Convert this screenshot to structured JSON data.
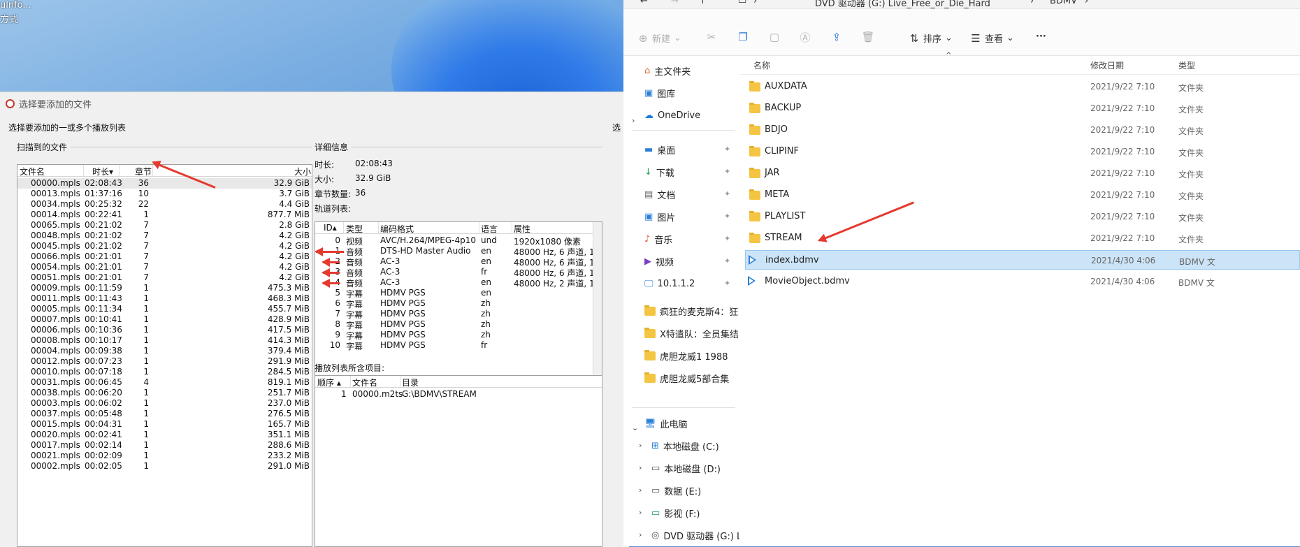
{
  "desktop": {
    "line1": "ulnfo...",
    "line2": "方式"
  },
  "dialog": {
    "title": "选择要添加的文件",
    "instruction": "选择要添加的一或多个播放列表",
    "right_cut": "选",
    "scanned_label": "扫描到的文件",
    "detail_label": "详细信息",
    "files_headers": [
      "文件名",
      "时长",
      "章节",
      "大小"
    ],
    "files": [
      {
        "name": "00000.mpls",
        "dur": "02:08:43",
        "ch": "36",
        "size": "32.9 GiB"
      },
      {
        "name": "00013.mpls",
        "dur": "01:37:16",
        "ch": "10",
        "size": "3.7 GiB"
      },
      {
        "name": "00034.mpls",
        "dur": "00:25:32",
        "ch": "22",
        "size": "4.4 GiB"
      },
      {
        "name": "00014.mpls",
        "dur": "00:22:41",
        "ch": "1",
        "size": "877.7 MiB"
      },
      {
        "name": "00065.mpls",
        "dur": "00:21:02",
        "ch": "7",
        "size": "2.8 GiB"
      },
      {
        "name": "00048.mpls",
        "dur": "00:21:02",
        "ch": "7",
        "size": "4.2 GiB"
      },
      {
        "name": "00045.mpls",
        "dur": "00:21:02",
        "ch": "7",
        "size": "4.2 GiB"
      },
      {
        "name": "00066.mpls",
        "dur": "00:21:01",
        "ch": "7",
        "size": "4.2 GiB"
      },
      {
        "name": "00054.mpls",
        "dur": "00:21:01",
        "ch": "7",
        "size": "4.2 GiB"
      },
      {
        "name": "00051.mpls",
        "dur": "00:21:01",
        "ch": "7",
        "size": "4.2 GiB"
      },
      {
        "name": "00009.mpls",
        "dur": "00:11:59",
        "ch": "1",
        "size": "475.3 MiB"
      },
      {
        "name": "00011.mpls",
        "dur": "00:11:43",
        "ch": "1",
        "size": "468.3 MiB"
      },
      {
        "name": "00005.mpls",
        "dur": "00:11:34",
        "ch": "1",
        "size": "455.7 MiB"
      },
      {
        "name": "00007.mpls",
        "dur": "00:10:41",
        "ch": "1",
        "size": "428.9 MiB"
      },
      {
        "name": "00006.mpls",
        "dur": "00:10:36",
        "ch": "1",
        "size": "417.5 MiB"
      },
      {
        "name": "00008.mpls",
        "dur": "00:10:17",
        "ch": "1",
        "size": "414.3 MiB"
      },
      {
        "name": "00004.mpls",
        "dur": "00:09:38",
        "ch": "1",
        "size": "379.4 MiB"
      },
      {
        "name": "00012.mpls",
        "dur": "00:07:23",
        "ch": "1",
        "size": "291.9 MiB"
      },
      {
        "name": "00010.mpls",
        "dur": "00:07:18",
        "ch": "1",
        "size": "284.5 MiB"
      },
      {
        "name": "00031.mpls",
        "dur": "00:06:45",
        "ch": "4",
        "size": "819.1 MiB"
      },
      {
        "name": "00038.mpls",
        "dur": "00:06:20",
        "ch": "1",
        "size": "251.7 MiB"
      },
      {
        "name": "00003.mpls",
        "dur": "00:06:02",
        "ch": "1",
        "size": "237.0 MiB"
      },
      {
        "name": "00037.mpls",
        "dur": "00:05:48",
        "ch": "1",
        "size": "276.5 MiB"
      },
      {
        "name": "00015.mpls",
        "dur": "00:04:31",
        "ch": "1",
        "size": "165.7 MiB"
      },
      {
        "name": "00020.mpls",
        "dur": "00:02:41",
        "ch": "1",
        "size": "351.1 MiB"
      },
      {
        "name": "00017.mpls",
        "dur": "00:02:14",
        "ch": "1",
        "size": "288.6 MiB"
      },
      {
        "name": "00021.mpls",
        "dur": "00:02:09",
        "ch": "1",
        "size": "233.2 MiB"
      },
      {
        "name": "00002.mpls",
        "dur": "00:02:05",
        "ch": "1",
        "size": "291.0 MiB"
      }
    ],
    "detail": {
      "duration_label": "时长:",
      "duration": "02:08:43",
      "size_label": "大小:",
      "size": "32.9 GiB",
      "chapters_label": "章节数量:",
      "chapters": "36",
      "tracks_label": "轨道列表:"
    },
    "track_headers": [
      "ID",
      "类型",
      "编码格式",
      "语言",
      "属性"
    ],
    "tracks": [
      {
        "id": "0",
        "type": "视频",
        "codec": "AVC/H.264/MPEG-4p10",
        "lang": "und",
        "attr": "1920x1080 像素"
      },
      {
        "id": "1",
        "type": "音频",
        "codec": "DTS-HD Master Audio",
        "lang": "en",
        "attr": "48000 Hz, 6 声道, 1"
      },
      {
        "id": "2",
        "type": "音频",
        "codec": "AC-3",
        "lang": "en",
        "attr": "48000 Hz, 6 声道, 1"
      },
      {
        "id": "3",
        "type": "音频",
        "codec": "AC-3",
        "lang": "fr",
        "attr": "48000 Hz, 6 声道, 1"
      },
      {
        "id": "4",
        "type": "音频",
        "codec": "AC-3",
        "lang": "en",
        "attr": "48000 Hz, 2 声道, 1"
      },
      {
        "id": "5",
        "type": "字幕",
        "codec": "HDMV PGS",
        "lang": "en",
        "attr": ""
      },
      {
        "id": "6",
        "type": "字幕",
        "codec": "HDMV PGS",
        "lang": "zh",
        "attr": ""
      },
      {
        "id": "7",
        "type": "字幕",
        "codec": "HDMV PGS",
        "lang": "zh",
        "attr": ""
      },
      {
        "id": "8",
        "type": "字幕",
        "codec": "HDMV PGS",
        "lang": "zh",
        "attr": ""
      },
      {
        "id": "9",
        "type": "字幕",
        "codec": "HDMV PGS",
        "lang": "zh",
        "attr": ""
      },
      {
        "id": "10",
        "type": "字幕",
        "codec": "HDMV PGS",
        "lang": "fr",
        "attr": ""
      }
    ],
    "playlist_items_label": "播放列表所含项目:",
    "playlist_headers": [
      "顺序",
      "文件名",
      "目录"
    ],
    "playlist_items": [
      {
        "order": "1",
        "file": "00000.m2ts",
        "dir": "G:\\BDMV\\STREAM"
      }
    ]
  },
  "explorer": {
    "breadcrumb": [
      "DVD 驱动器 (G:) Live_Free_or_Die_Hard",
      "BDMV"
    ],
    "toolbar": {
      "new": "新建",
      "sort": "排序",
      "view": "查看",
      "more": "···"
    },
    "nav": {
      "home": "主文件夹",
      "gallery": "图库",
      "onedrive": "OneDrive",
      "quick": [
        "桌面",
        "下载",
        "文档",
        "图片",
        "音乐",
        "视频",
        "10.1.1.2"
      ],
      "folders": [
        "疯狂的麦克斯4：狂",
        "X特遣队：全员集结",
        "虎胆龙威1 1988",
        "虎胆龙威5部合集"
      ],
      "pc": "此电脑",
      "drives": [
        "本地磁盘 (C:)",
        "本地磁盘 (D:)",
        "数据 (E:)",
        "影视 (F:)",
        "DVD 驱动器 (G:) L"
      ]
    },
    "headers": {
      "name": "名称",
      "date": "修改日期",
      "type": "类型"
    },
    "files": [
      {
        "name": "AUXDATA",
        "date": "2021/9/22 7:10",
        "type": "文件夹"
      },
      {
        "name": "BACKUP",
        "date": "2021/9/22 7:10",
        "type": "文件夹"
      },
      {
        "name": "BDJO",
        "date": "2021/9/22 7:10",
        "type": "文件夹"
      },
      {
        "name": "CLIPINF",
        "date": "2021/9/22 7:10",
        "type": "文件夹"
      },
      {
        "name": "JAR",
        "date": "2021/9/22 7:10",
        "type": "文件夹"
      },
      {
        "name": "META",
        "date": "2021/9/22 7:10",
        "type": "文件夹"
      },
      {
        "name": "PLAYLIST",
        "date": "2021/9/22 7:10",
        "type": "文件夹"
      },
      {
        "name": "STREAM",
        "date": "2021/9/22 7:10",
        "type": "文件夹"
      },
      {
        "name": "index.bdmv",
        "date": "2021/4/30 4:06",
        "type": "BDMV 文"
      },
      {
        "name": "MovieObject.bdmv",
        "date": "2021/4/30 4:06",
        "type": "BDMV 文"
      }
    ]
  },
  "colors": {
    "arrow": "#e53a2f",
    "selection": "#cce4f7",
    "folder": "#f4c542"
  }
}
